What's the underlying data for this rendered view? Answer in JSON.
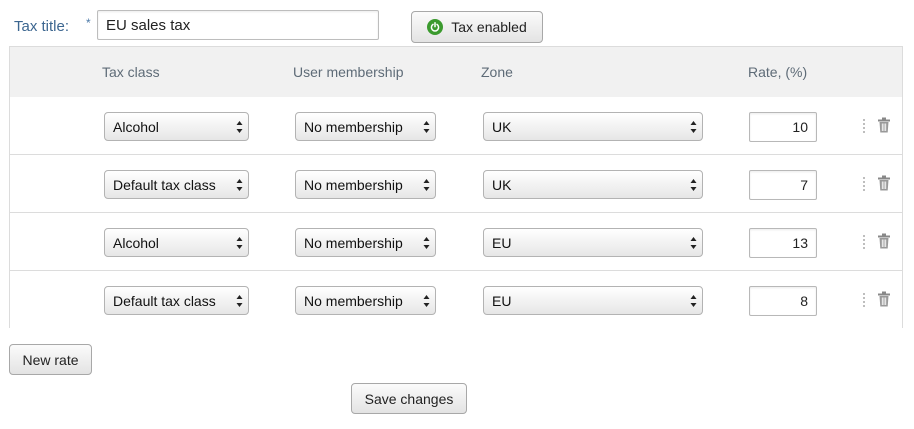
{
  "form": {
    "title_label": "Tax title:",
    "required_mark": "*",
    "title_value": "EU sales tax",
    "tax_status_label": "Tax enabled"
  },
  "table": {
    "headers": {
      "tax_class": "Tax class",
      "membership": "User membership",
      "zone": "Zone",
      "rate": "Rate, (%)"
    },
    "rows": [
      {
        "tax_class": "Alcohol",
        "membership": "No membership",
        "zone": "UK",
        "rate": "10"
      },
      {
        "tax_class": "Default tax class",
        "membership": "No membership",
        "zone": "UK",
        "rate": "7"
      },
      {
        "tax_class": "Alcohol",
        "membership": "No membership",
        "zone": "EU",
        "rate": "13"
      },
      {
        "tax_class": "Default tax class",
        "membership": "No membership",
        "zone": "EU",
        "rate": "8"
      }
    ]
  },
  "actions": {
    "new_rate_label": "New rate",
    "save_label": "Save changes"
  },
  "icons": {
    "power": "power-icon",
    "drag": "drag-handle-icon",
    "delete": "trash-icon",
    "select_arrows": "select-arrows-icon"
  },
  "colors": {
    "label_blue": "#3c6690",
    "enabled_green": "#3b9a2e",
    "header_bg": "#f1f1f1"
  }
}
